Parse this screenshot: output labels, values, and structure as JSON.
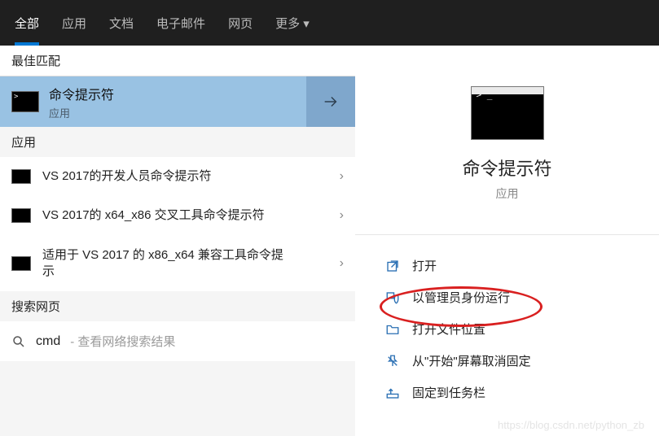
{
  "tabs": {
    "all": "全部",
    "apps": "应用",
    "docs": "文档",
    "email": "电子邮件",
    "web": "网页",
    "more": "更多 ▾"
  },
  "left": {
    "best_match_header": "最佳匹配",
    "best_match": {
      "title": "命令提示符",
      "subtitle": "应用"
    },
    "apps_header": "应用",
    "apps": [
      {
        "label": "VS 2017的开发人员命令提示符"
      },
      {
        "label": "VS 2017的 x64_x86 交叉工具命令提示符"
      },
      {
        "label": "适用于 VS 2017 的 x86_x64 兼容工具命令提示"
      }
    ],
    "web_header": "搜索网页",
    "web": {
      "keyword": "cmd",
      "desc": " - 查看网络搜索结果"
    }
  },
  "right": {
    "title": "命令提示符",
    "subtitle": "应用",
    "actions": {
      "open": "打开",
      "run_admin": "以管理员身份运行",
      "open_loc": "打开文件位置",
      "unpin_start": "从\"开始\"屏幕取消固定",
      "pin_taskbar": "固定到任务栏"
    }
  },
  "watermark": "https://blog.csdn.net/python_zb"
}
